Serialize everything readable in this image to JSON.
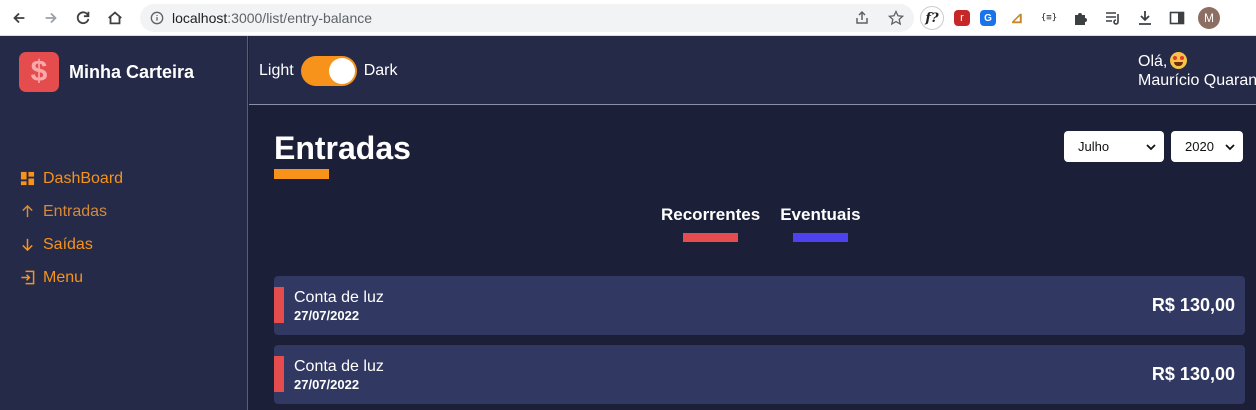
{
  "browser": {
    "url_host": "localhost",
    "url_path": ":3000/list/entry-balance",
    "profile_initial": "M",
    "extensions": [
      "f?",
      "r",
      "G",
      "⊿",
      "{≡}"
    ]
  },
  "sidebar": {
    "brand_symbol": "$",
    "brand_name": "Minha Carteira",
    "items": [
      {
        "label": "DashBoard",
        "icon": "dashboard-icon"
      },
      {
        "label": "Entradas",
        "icon": "arrow-up-icon"
      },
      {
        "label": "Saídas",
        "icon": "arrow-down-icon"
      },
      {
        "label": "Menu",
        "icon": "exit-icon"
      }
    ]
  },
  "header": {
    "theme_left": "Light",
    "theme_right": "Dark",
    "greeting": "Olá,",
    "user_name": "Maurício Quarant"
  },
  "main": {
    "title": "Entradas",
    "month": "Julho",
    "year": "2020",
    "tabs": [
      {
        "label": "Recorrentes",
        "color": "#e44c4e"
      },
      {
        "label": "Eventuais",
        "color": "#4e41f0"
      }
    ],
    "entries": [
      {
        "description": "Conta de luz",
        "date": "27/07/2022",
        "amount": "R$ 130,00"
      },
      {
        "description": "Conta de luz",
        "date": "27/07/2022",
        "amount": "R$ 130,00"
      }
    ]
  },
  "colors": {
    "accent": "#f7931b",
    "primary_bg": "#1b1f38",
    "secondary_bg": "#252a48",
    "card_bg": "#313862",
    "tag_red": "#e44c4e"
  }
}
